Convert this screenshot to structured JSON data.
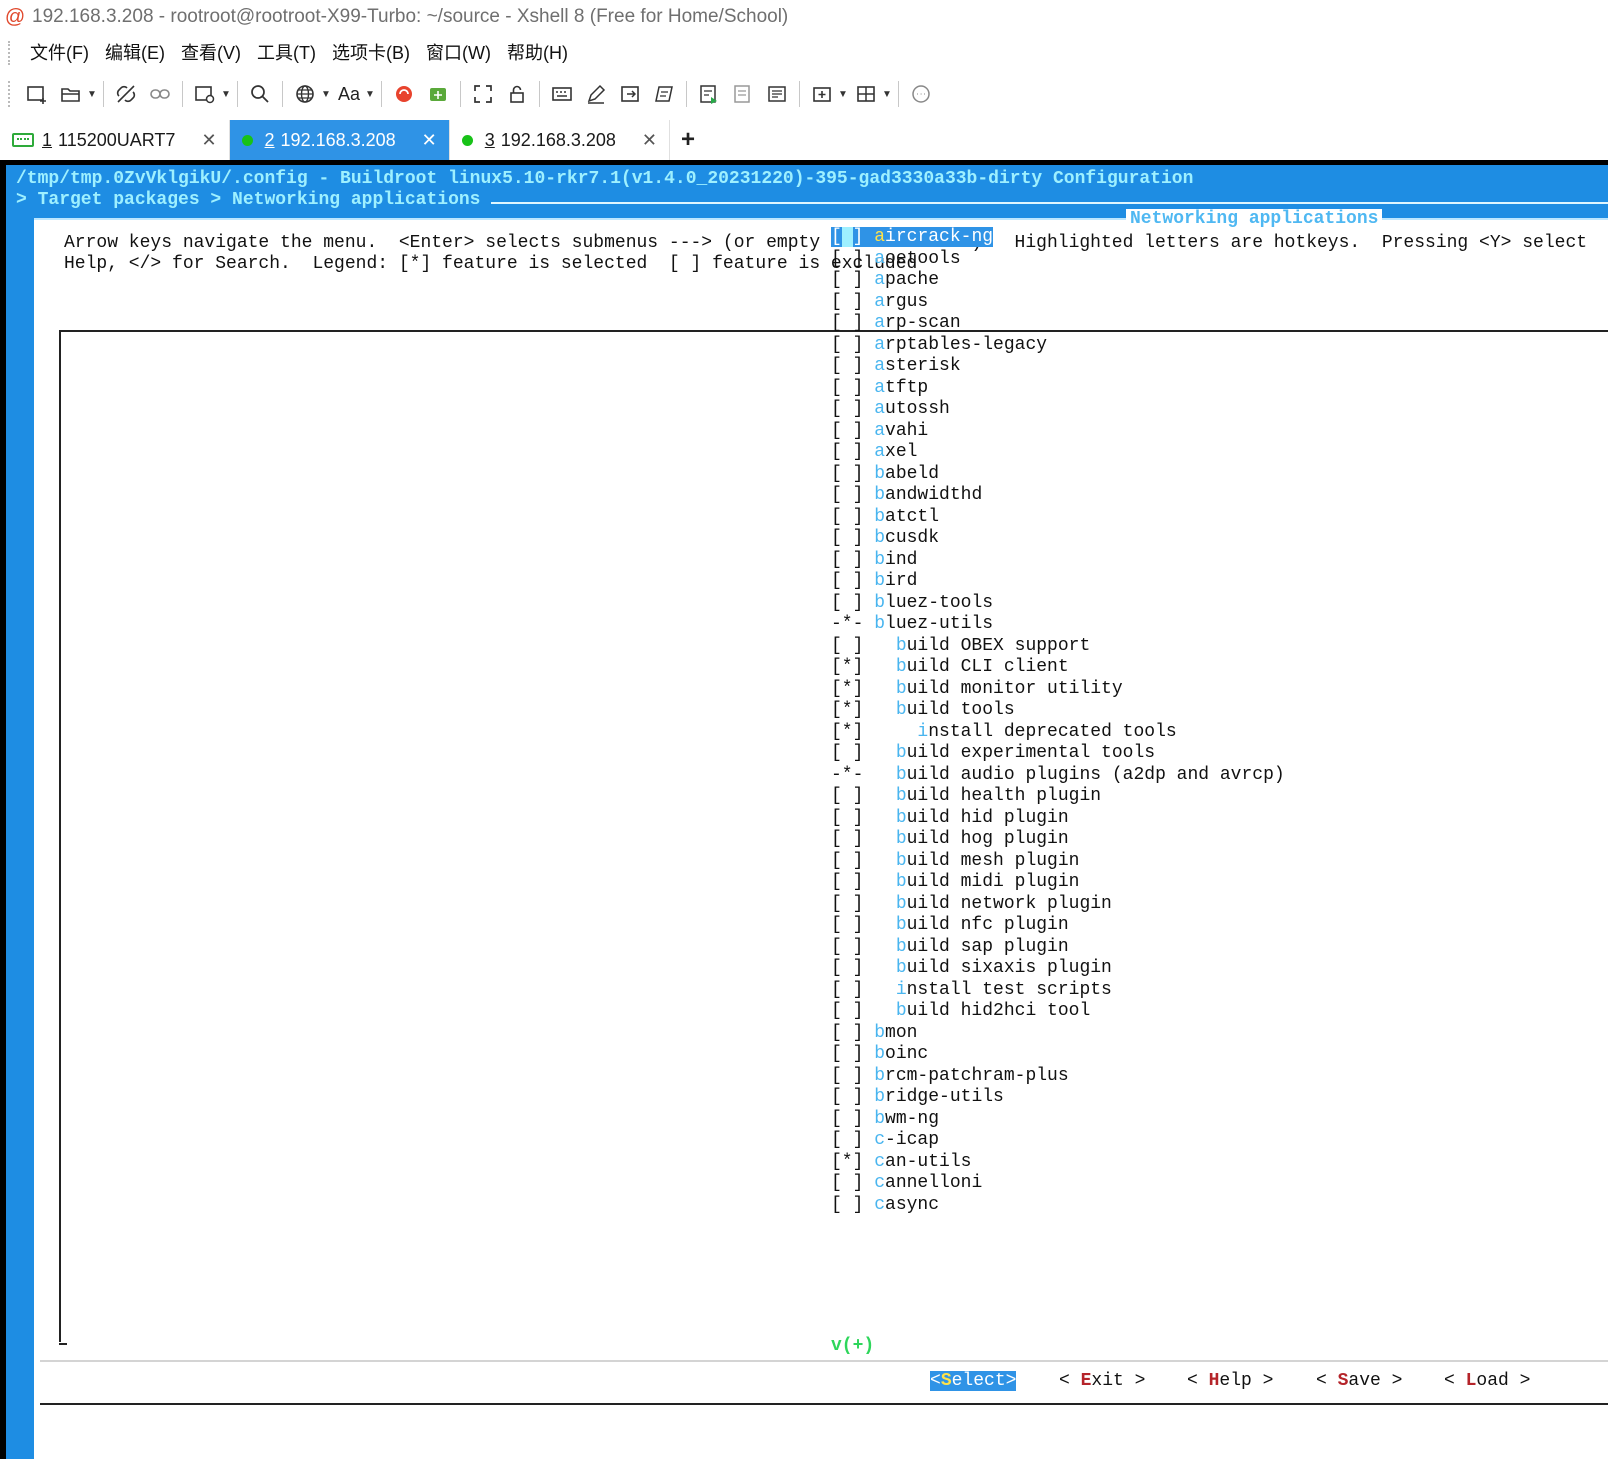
{
  "window": {
    "title": "192.168.3.208 - rootroot@rootroot-X99-Turbo: ~/source - Xshell 8 (Free for Home/School)"
  },
  "menubar": {
    "items": [
      "文件(F)",
      "编辑(E)",
      "查看(V)",
      "工具(T)",
      "选项卡(B)",
      "窗口(W)",
      "帮助(H)"
    ]
  },
  "toolbar": {
    "icons": [
      "new-session-icon",
      "open-folder-icon",
      "disconnect-icon",
      "reconnect-link-icon",
      "new-tab-settings-icon",
      "search-icon",
      "globe-icon",
      "font-icon",
      "xftp-icon",
      "transfer-icon",
      "fullscreen-icon",
      "lock-icon",
      "keyboard-icon",
      "compose-icon",
      "script-icon",
      "quick-command-icon",
      "log-icon",
      "print-icon",
      "notes-icon",
      "add-tab-icon",
      "layout-icon",
      "chat-icon"
    ],
    "font_label": "Aa"
  },
  "tabs": [
    {
      "num": "1",
      "label": "115200UART7",
      "type": "serial",
      "active": false
    },
    {
      "num": "2",
      "label": "192.168.3.208",
      "type": "ssh",
      "active": true
    },
    {
      "num": "3",
      "label": "192.168.3.208",
      "type": "ssh",
      "active": false
    }
  ],
  "tab_add": "+",
  "terminal": {
    "config_path": "/tmp/tmp.0ZvVklgikU/.config - Buildroot linux5.10-rkr7.1(v1.4.0_20231220)-395-gad3330a33b-dirty Configuration",
    "breadcrumb": "> Target packages > Networking applications",
    "dialog_title": "Networking applications",
    "help_line1": "Arrow keys navigate the menu.  <Enter> selects submenus ---> (or empty submenus ----).  Highlighted letters are hotkeys.  Pressing <Y> select",
    "help_line2": "Help, </> for Search.  Legend: [*] feature is selected  [ ] feature is excluded",
    "more_indicator": "v(+)",
    "menu_items": [
      {
        "state": "[ ]",
        "indent": 0,
        "label": "aircrack-ng",
        "selected": true
      },
      {
        "state": "[ ]",
        "indent": 0,
        "label": "aoetools"
      },
      {
        "state": "[ ]",
        "indent": 0,
        "label": "apache"
      },
      {
        "state": "[ ]",
        "indent": 0,
        "label": "argus"
      },
      {
        "state": "[ ]",
        "indent": 0,
        "label": "arp-scan"
      },
      {
        "state": "[ ]",
        "indent": 0,
        "label": "arptables-legacy"
      },
      {
        "state": "[ ]",
        "indent": 0,
        "label": "asterisk"
      },
      {
        "state": "[ ]",
        "indent": 0,
        "label": "atftp"
      },
      {
        "state": "[ ]",
        "indent": 0,
        "label": "autossh"
      },
      {
        "state": "[ ]",
        "indent": 0,
        "label": "avahi"
      },
      {
        "state": "[ ]",
        "indent": 0,
        "label": "axel"
      },
      {
        "state": "[ ]",
        "indent": 0,
        "label": "babeld"
      },
      {
        "state": "[ ]",
        "indent": 0,
        "label": "bandwidthd"
      },
      {
        "state": "[ ]",
        "indent": 0,
        "label": "batctl"
      },
      {
        "state": "[ ]",
        "indent": 0,
        "label": "bcusdk"
      },
      {
        "state": "[ ]",
        "indent": 0,
        "label": "bind"
      },
      {
        "state": "[ ]",
        "indent": 0,
        "label": "bird"
      },
      {
        "state": "[ ]",
        "indent": 0,
        "label": "bluez-tools"
      },
      {
        "state": "-*-",
        "indent": 0,
        "label": "bluez-utils"
      },
      {
        "state": "[ ]",
        "indent": 1,
        "label": "build OBEX support"
      },
      {
        "state": "[*]",
        "indent": 1,
        "label": "build CLI client"
      },
      {
        "state": "[*]",
        "indent": 1,
        "label": "build monitor utility"
      },
      {
        "state": "[*]",
        "indent": 1,
        "label": "build tools"
      },
      {
        "state": "[*]",
        "indent": 2,
        "label": "install deprecated tools"
      },
      {
        "state": "[ ]",
        "indent": 1,
        "label": "build experimental tools"
      },
      {
        "state": "-*-",
        "indent": 1,
        "label": "build audio plugins (a2dp and avrcp)"
      },
      {
        "state": "[ ]",
        "indent": 1,
        "label": "build health plugin"
      },
      {
        "state": "[ ]",
        "indent": 1,
        "label": "build hid plugin"
      },
      {
        "state": "[ ]",
        "indent": 1,
        "label": "build hog plugin"
      },
      {
        "state": "[ ]",
        "indent": 1,
        "label": "build mesh plugin"
      },
      {
        "state": "[ ]",
        "indent": 1,
        "label": "build midi plugin"
      },
      {
        "state": "[ ]",
        "indent": 1,
        "label": "build network plugin"
      },
      {
        "state": "[ ]",
        "indent": 1,
        "label": "build nfc plugin"
      },
      {
        "state": "[ ]",
        "indent": 1,
        "label": "build sap plugin"
      },
      {
        "state": "[ ]",
        "indent": 1,
        "label": "build sixaxis plugin"
      },
      {
        "state": "[ ]",
        "indent": 1,
        "label": "install test scripts"
      },
      {
        "state": "[ ]",
        "indent": 1,
        "label": "build hid2hci tool"
      },
      {
        "state": "[ ]",
        "indent": 0,
        "label": "bmon"
      },
      {
        "state": "[ ]",
        "indent": 0,
        "label": "boinc"
      },
      {
        "state": "[ ]",
        "indent": 0,
        "label": "brcm-patchram-plus"
      },
      {
        "state": "[ ]",
        "indent": 0,
        "label": "bridge-utils"
      },
      {
        "state": "[ ]",
        "indent": 0,
        "label": "bwm-ng"
      },
      {
        "state": "[ ]",
        "indent": 0,
        "label": "c-icap"
      },
      {
        "state": "[*]",
        "indent": 0,
        "label": "can-utils"
      },
      {
        "state": "[ ]",
        "indent": 0,
        "label": "cannelloni"
      },
      {
        "state": "[ ]",
        "indent": 0,
        "label": "casync"
      }
    ],
    "buttons": [
      {
        "label": "<Select>",
        "active": true
      },
      {
        "label": "< Exit >"
      },
      {
        "label": "< Help >"
      },
      {
        "label": "< Save >"
      },
      {
        "label": "< Load >"
      }
    ]
  },
  "colors": {
    "terminal_blue": "#1e8de3",
    "tab_active": "#2f93e6",
    "hotkey": "#49b5ef",
    "more_indicator": "#2ed65b",
    "button_hotkey": "#b5242a"
  }
}
